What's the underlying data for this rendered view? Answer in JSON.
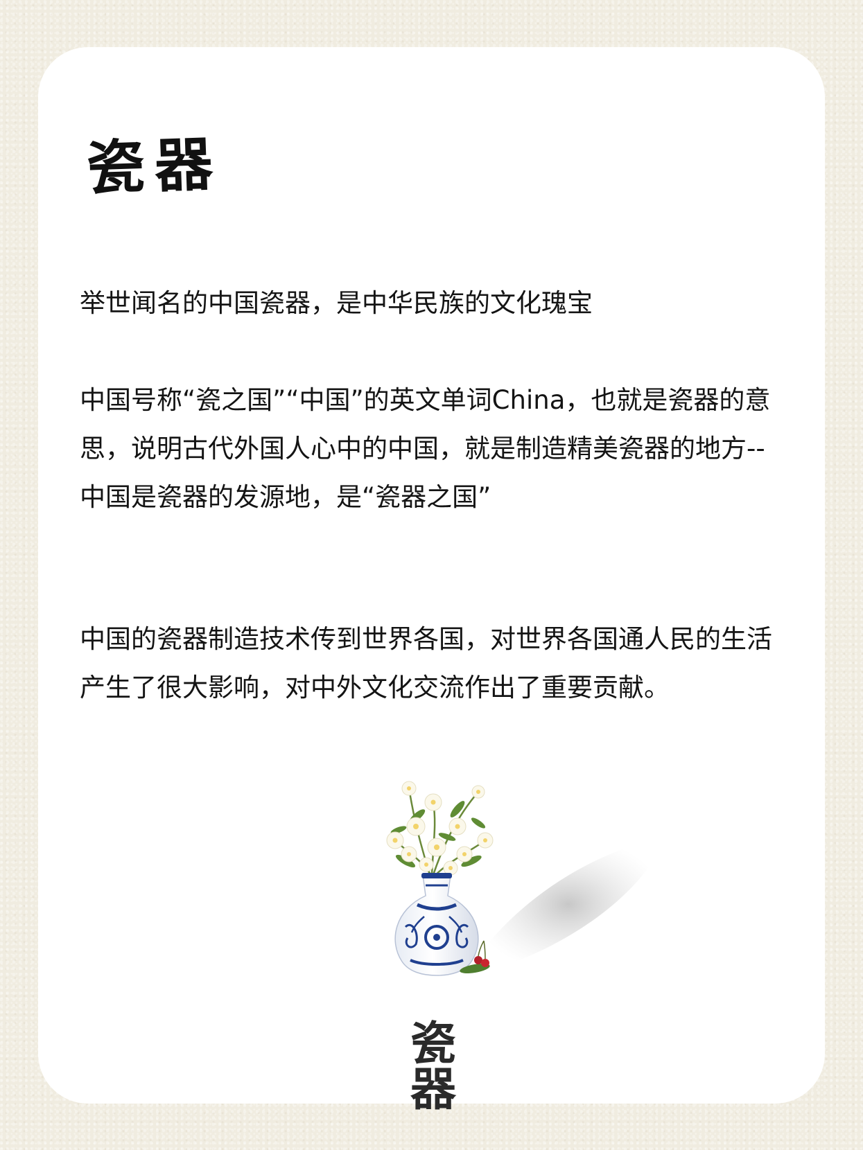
{
  "title": "瓷器",
  "paragraphs": [
    "举世闻名的中国瓷器，是中华民族的文化瑰宝",
    "中国号称“瓷之国”“中国”的英文单词China，也就是瓷器的意思，说明古代外国人心中的中国，就是制造精美瓷器的地方--中国是瓷器的发源地，是“瓷器之国”",
    "中国的瓷器制造技术传到世界各国，对世界各国通人民的生活产生了很大影响，对中外文化交流作出了重要贡献。"
  ],
  "illustration": {
    "icon": "flower-vase-icon",
    "caption": "瓷器"
  },
  "colors": {
    "page_background": "#f0ece0",
    "card": "#ffffff",
    "text": "#141414",
    "porcelain_blue": "#1f3f8f"
  }
}
